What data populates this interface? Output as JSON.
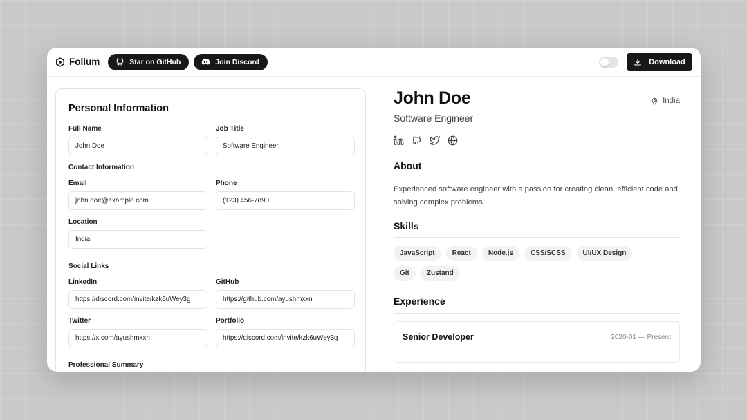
{
  "header": {
    "brand": "Folium",
    "github_label": "Star on GitHub",
    "discord_label": "Join Discord",
    "download_label": "Download"
  },
  "form": {
    "title": "Personal Information",
    "full_name_label": "Full Name",
    "full_name_value": "John Doe",
    "job_title_label": "Job Title",
    "job_title_value": "Software Engineer",
    "contact_section": "Contact Information",
    "email_label": "Email",
    "email_value": "john.doe@example.com",
    "phone_label": "Phone",
    "phone_value": "(123) 456-7890",
    "location_label": "Location",
    "location_value": "India",
    "social_section": "Social Links",
    "linkedin_label": "LinkedIn",
    "linkedin_value": "https://discord.com/invite/kzk6uWey3g",
    "github_label": "GitHub",
    "github_value": "https://github.com/ayushmxxn",
    "twitter_label": "Twitter",
    "twitter_value": "https://x.com/ayushmxxn",
    "portfolio_label": "Portfolio",
    "portfolio_value": "https://discord.com/invite/kzk6uWey3g",
    "summary_label": "Professional Summary"
  },
  "preview": {
    "name": "John Doe",
    "title": "Software Engineer",
    "location": "India",
    "about_heading": "About",
    "about_text": "Experienced software engineer with a passion for creating clean, efficient code and solving complex problems.",
    "skills_heading": "Skills",
    "skills": [
      "JavaScript",
      "React",
      "Node.js",
      "CSS/SCSS",
      "UI/UX Design",
      "Git",
      "Zustand"
    ],
    "experience_heading": "Experience",
    "experience": [
      {
        "role": "Senior Developer",
        "dates": "2020-01 — Present"
      }
    ]
  },
  "theme": {
    "accent": "#18181b",
    "toggle_off": "#e5e5e5"
  }
}
